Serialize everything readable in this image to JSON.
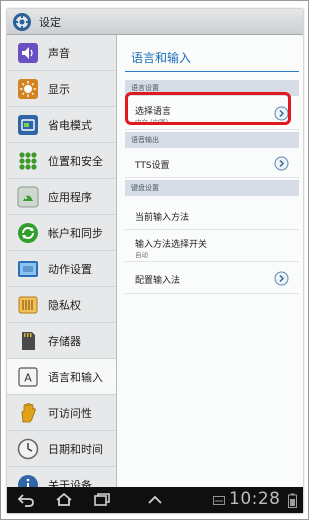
{
  "app": {
    "title": "设定",
    "icon": "settings-gear-icon"
  },
  "sidebar": {
    "items": [
      {
        "label": "声音",
        "icon": "speaker-icon",
        "color": "#6a4fc4"
      },
      {
        "label": "显示",
        "icon": "brightness-icon",
        "color": "#d2821e"
      },
      {
        "label": "省电模式",
        "icon": "battery-saver-icon",
        "color": "#2f66a8"
      },
      {
        "label": "位置和安全",
        "icon": "location-grid-icon",
        "color": "#3d9a2a"
      },
      {
        "label": "应用程序",
        "icon": "applications-icon",
        "color": "#3a9a34"
      },
      {
        "label": "帐户和同步",
        "icon": "sync-icon",
        "color": "#2f9e2a"
      },
      {
        "label": "动作设置",
        "icon": "motion-icon",
        "color": "#2b6fb4"
      },
      {
        "label": "隐私权",
        "icon": "privacy-icon",
        "color": "#d28a1f"
      },
      {
        "label": "存储器",
        "icon": "storage-icon",
        "color": "#4a4a4a"
      },
      {
        "label": "语言和输入",
        "icon": "language-icon",
        "color": "#333333"
      },
      {
        "label": "可访问性",
        "icon": "accessibility-hand-icon",
        "color": "#e0a21a"
      },
      {
        "label": "日期和时间",
        "icon": "clock-icon",
        "color": "#666666"
      },
      {
        "label": "关于设备",
        "icon": "info-icon",
        "color": "#2f66a8"
      }
    ],
    "selected": "语言和输入"
  },
  "content": {
    "title": "语言和输入",
    "sections": [
      {
        "header": "语言设置"
      },
      {
        "header": "语音输出"
      },
      {
        "header": "键盘设置"
      }
    ],
    "rows": {
      "select_language": {
        "title": "选择语言",
        "subtitle": "中文 (中国)"
      },
      "tts": {
        "title": "TTS设置"
      },
      "current_input": {
        "title": "当前输入方法"
      },
      "input_selector": {
        "title": "输入方法选择开关",
        "subtitle": "自动"
      },
      "configure_input": {
        "title": "配置输入法"
      }
    }
  },
  "statusbar": {
    "time": "10:28"
  },
  "colors": {
    "accent": "#1c6dba",
    "highlight": "#e0181f"
  }
}
